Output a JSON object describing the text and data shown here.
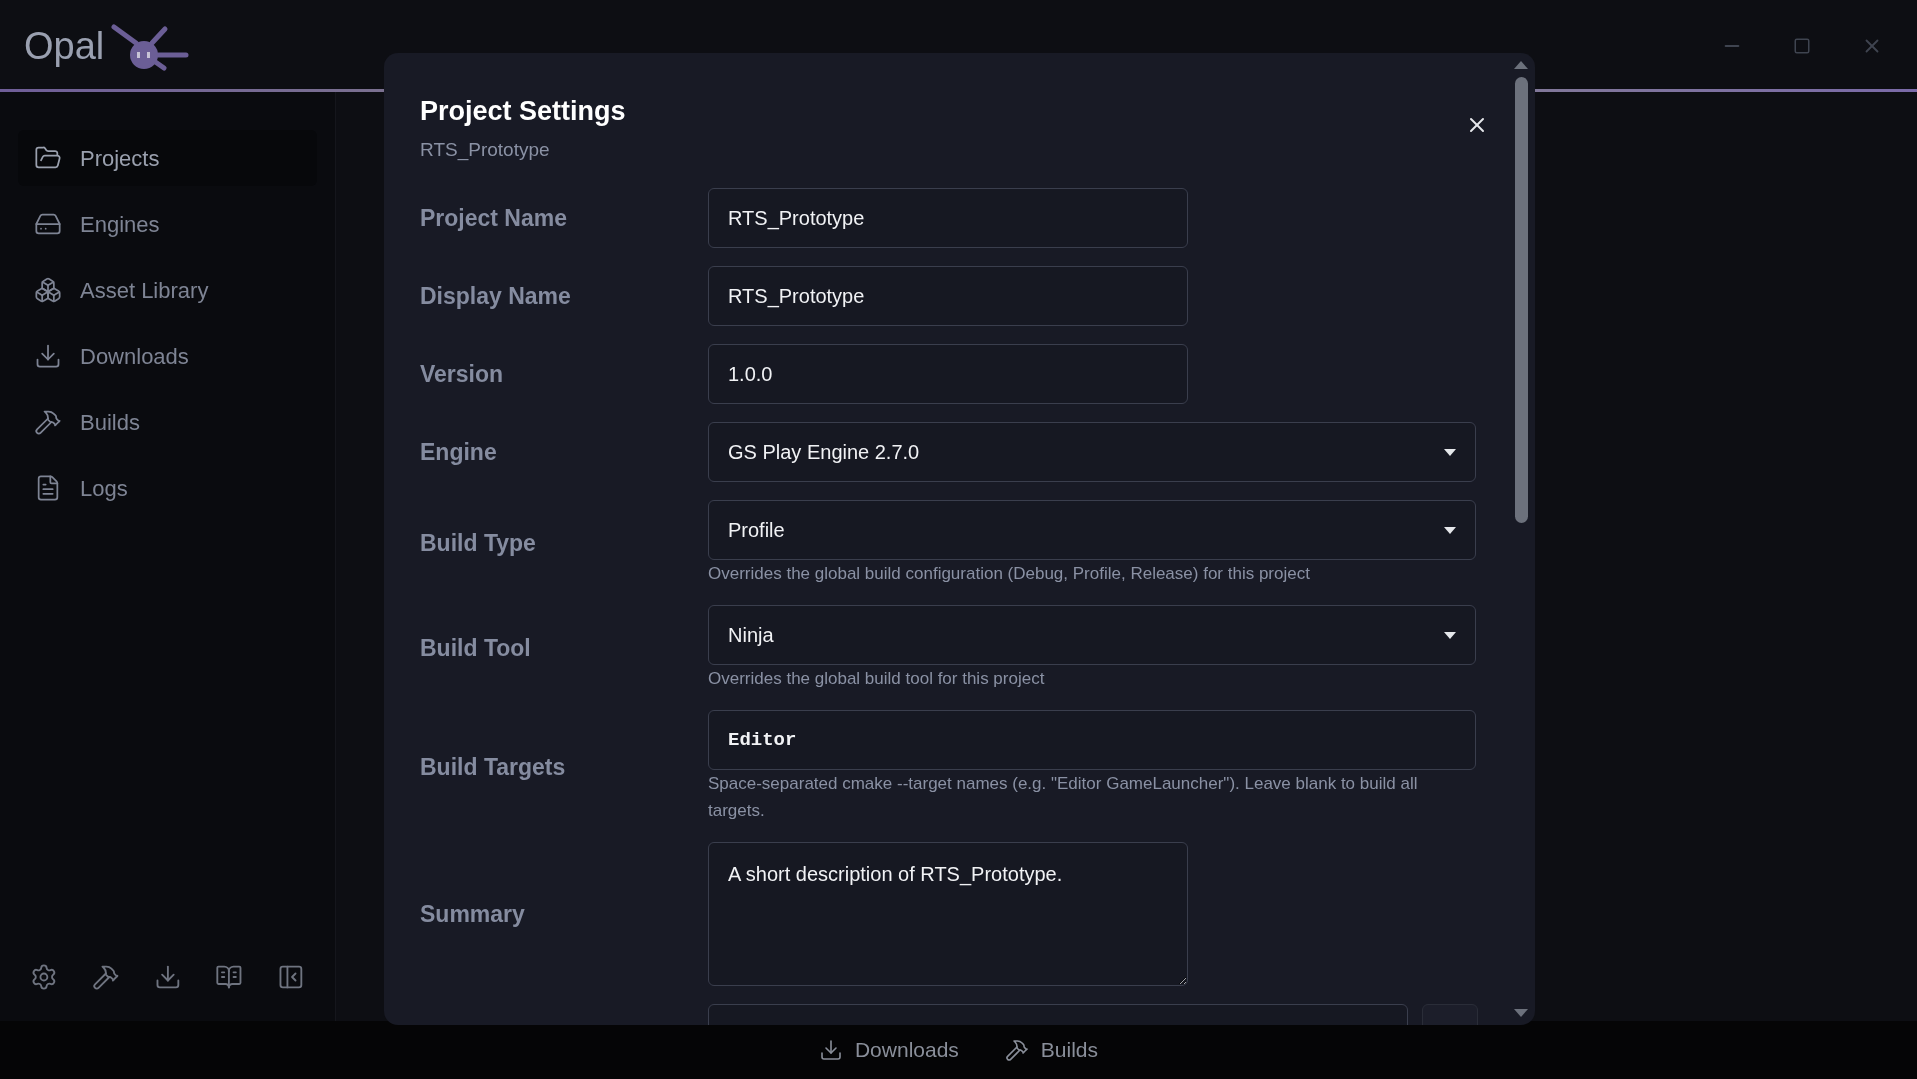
{
  "app": {
    "name": "Opal"
  },
  "sidebar": {
    "items": [
      {
        "label": "Projects",
        "selected": true
      },
      {
        "label": "Engines",
        "selected": false
      },
      {
        "label": "Asset Library",
        "selected": false
      },
      {
        "label": "Downloads",
        "selected": false
      },
      {
        "label": "Builds",
        "selected": false
      },
      {
        "label": "Logs",
        "selected": false
      }
    ]
  },
  "dialog": {
    "title": "Project Settings",
    "subtitle": "RTS_Prototype",
    "fields": [
      {
        "kind": "text",
        "label": "Project Name",
        "value": "RTS_Prototype"
      },
      {
        "kind": "text",
        "label": "Display Name",
        "value": "RTS_Prototype"
      },
      {
        "kind": "text",
        "label": "Version",
        "value": "1.0.0"
      },
      {
        "kind": "select",
        "label": "Engine",
        "value": "GS Play Engine 2.7.0"
      },
      {
        "kind": "select",
        "label": "Build Type",
        "value": "Profile",
        "hint": "Overrides the global build configuration (Debug, Profile, Release) for this project"
      },
      {
        "kind": "select",
        "label": "Build Tool",
        "value": "Ninja",
        "hint": "Overrides the global build tool for this project"
      },
      {
        "kind": "code",
        "label": "Build Targets",
        "value": "Editor",
        "hint": "Space-separated cmake --target names (e.g. \"Editor GameLauncher\"). Leave blank to build all targets."
      },
      {
        "kind": "textarea",
        "label": "Summary",
        "value": "A short description of RTS_Prototype."
      }
    ]
  },
  "bottom_bar": {
    "items": [
      {
        "label": "Downloads"
      },
      {
        "label": "Builds"
      }
    ]
  }
}
